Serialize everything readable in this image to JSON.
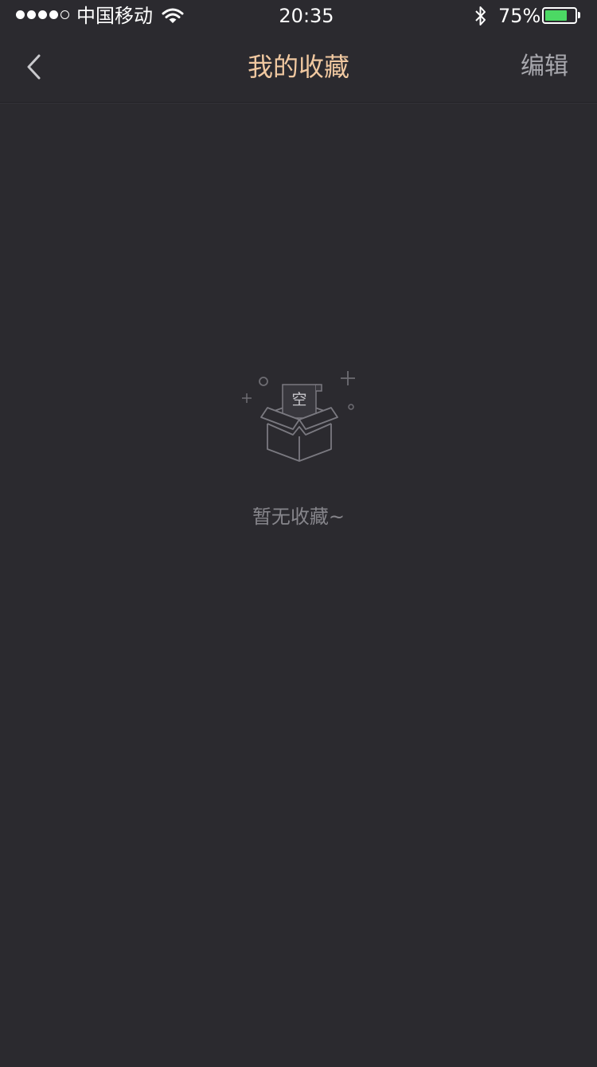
{
  "status_bar": {
    "carrier": "中国移动",
    "time": "20:35",
    "battery_percent": "75%",
    "battery_level": 0.75,
    "signal_icon": "signal-dots-icon",
    "wifi_icon": "wifi-icon",
    "bluetooth_icon": "bluetooth-icon",
    "battery_icon": "battery-icon"
  },
  "nav": {
    "title": "我的收藏",
    "edit_label": "编辑",
    "back_icon": "chevron-left-icon"
  },
  "empty_state": {
    "card_label": "空",
    "message": "暂无收藏~",
    "icon": "empty-box-icon"
  },
  "colors": {
    "background": "#2b2a2f",
    "title_accent": "#f0c8a0",
    "battery_fill": "#4cd964",
    "muted_text": "#86858b"
  }
}
